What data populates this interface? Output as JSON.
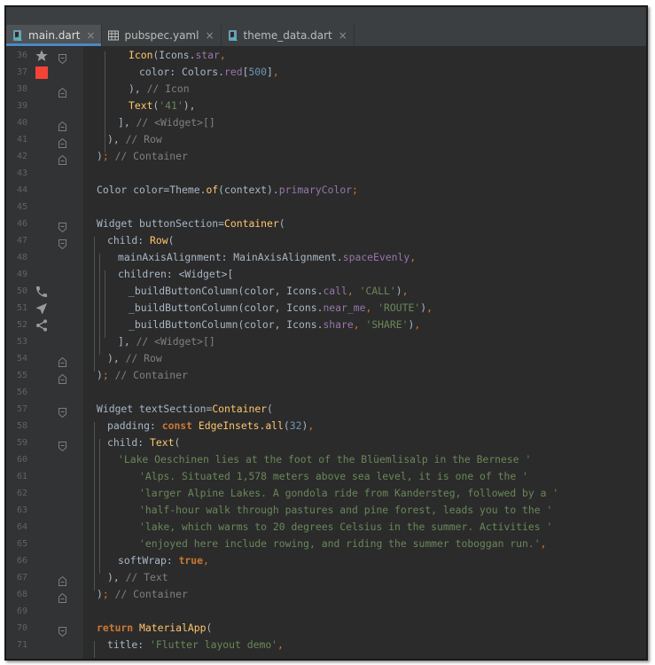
{
  "tabs": [
    {
      "label": "main.dart",
      "icon": "dart-file-icon",
      "active": true
    },
    {
      "label": "pubspec.yaml",
      "icon": "table-file-icon",
      "active": false
    },
    {
      "label": "theme_data.dart",
      "icon": "dart-file-icon",
      "active": false
    }
  ],
  "close_glyph": "×",
  "colors": {
    "background": "#2b2b2b",
    "gutter": "#313335",
    "keyword": "#cc7832",
    "string": "#6a8759",
    "number": "#6897bb",
    "property": "#9876aa",
    "class": "#ffc66d",
    "comment": "#808080",
    "text": "#a9b7c6",
    "active_tab_underline": "#4a88c7"
  },
  "lines": [
    {
      "n": "36",
      "marker": "star-icon",
      "fold": "cap",
      "tokens": [
        [
          "cls",
          "Icon"
        ],
        [
          "plain",
          "(Icons."
        ],
        [
          "prop",
          "star"
        ],
        [
          "pun",
          ","
        ]
      ]
    },
    {
      "n": "37",
      "marker": "red-color-swatch-icon",
      "fold": "",
      "tokens": [
        [
          "plain",
          "color: Colors."
        ],
        [
          "prop",
          "red"
        ],
        [
          "plain",
          "["
        ],
        [
          "num",
          "500"
        ],
        [
          "plain",
          "]"
        ],
        [
          "pun",
          ","
        ]
      ]
    },
    {
      "n": "38",
      "marker": "",
      "fold": "end",
      "tokens": [
        [
          "plain",
          "), "
        ],
        [
          "cmt",
          "// Icon"
        ]
      ]
    },
    {
      "n": "39",
      "marker": "",
      "fold": "",
      "tokens": [
        [
          "cls",
          "Text"
        ],
        [
          "plain",
          "("
        ],
        [
          "str",
          "'41'"
        ],
        [
          "plain",
          "),"
        ]
      ]
    },
    {
      "n": "40",
      "marker": "",
      "fold": "end",
      "tokens": [
        [
          "plain",
          "], "
        ],
        [
          "cmt",
          "// <Widget>[]"
        ]
      ]
    },
    {
      "n": "41",
      "marker": "",
      "fold": "end",
      "tokens": [
        [
          "plain",
          "), "
        ],
        [
          "cmt",
          "// Row"
        ]
      ]
    },
    {
      "n": "42",
      "marker": "",
      "fold": "end",
      "tokens": [
        [
          "plain",
          ")"
        ],
        [
          "pun",
          ";"
        ],
        [
          "plain",
          " "
        ],
        [
          "cmt",
          "// Container"
        ]
      ]
    },
    {
      "n": "43",
      "marker": "",
      "fold": "",
      "tokens": []
    },
    {
      "n": "44",
      "marker": "",
      "fold": "",
      "tokens": [
        [
          "plain",
          "Color color=Theme."
        ],
        [
          "fn",
          "of"
        ],
        [
          "plain",
          "(context)."
        ],
        [
          "prop",
          "primaryColor"
        ],
        [
          "pun",
          ";"
        ]
      ]
    },
    {
      "n": "45",
      "marker": "",
      "fold": "",
      "tokens": []
    },
    {
      "n": "46",
      "marker": "",
      "fold": "cap",
      "tokens": [
        [
          "plain",
          "Widget buttonSection="
        ],
        [
          "cls",
          "Container"
        ],
        [
          "plain",
          "("
        ]
      ]
    },
    {
      "n": "47",
      "marker": "",
      "fold": "cap",
      "tokens": [
        [
          "plain",
          "child: "
        ],
        [
          "cls",
          "Row"
        ],
        [
          "plain",
          "("
        ]
      ]
    },
    {
      "n": "48",
      "marker": "",
      "fold": "",
      "tokens": [
        [
          "plain",
          "mainAxisAlignment: MainAxisAlignment."
        ],
        [
          "prop",
          "spaceEvenly"
        ],
        [
          "pun",
          ","
        ]
      ]
    },
    {
      "n": "49",
      "marker": "",
      "fold": "",
      "tokens": [
        [
          "plain",
          "children: <Widget>["
        ]
      ]
    },
    {
      "n": "50",
      "marker": "phone-icon",
      "fold": "",
      "tokens": [
        [
          "plain",
          "_buildButtonColumn(color, Icons."
        ],
        [
          "prop",
          "call"
        ],
        [
          "pun",
          ", "
        ],
        [
          "str",
          "'CALL'"
        ],
        [
          "plain",
          ")"
        ],
        [
          "pun",
          ","
        ]
      ]
    },
    {
      "n": "51",
      "marker": "navigation-arrow-icon",
      "fold": "",
      "tokens": [
        [
          "plain",
          "_buildButtonColumn(color, Icons."
        ],
        [
          "prop",
          "near_me"
        ],
        [
          "pun",
          ", "
        ],
        [
          "str",
          "'ROUTE'"
        ],
        [
          "plain",
          ")"
        ],
        [
          "pun",
          ","
        ]
      ]
    },
    {
      "n": "52",
      "marker": "share-icon",
      "fold": "",
      "tokens": [
        [
          "plain",
          "_buildButtonColumn(color, Icons."
        ],
        [
          "prop",
          "share"
        ],
        [
          "pun",
          ", "
        ],
        [
          "str",
          "'SHARE'"
        ],
        [
          "plain",
          ")"
        ],
        [
          "pun",
          ","
        ]
      ]
    },
    {
      "n": "53",
      "marker": "",
      "fold": "",
      "tokens": [
        [
          "plain",
          "], "
        ],
        [
          "cmt",
          "// <Widget>[]"
        ]
      ]
    },
    {
      "n": "54",
      "marker": "",
      "fold": "end",
      "tokens": [
        [
          "plain",
          "), "
        ],
        [
          "cmt",
          "// Row"
        ]
      ]
    },
    {
      "n": "55",
      "marker": "",
      "fold": "end",
      "tokens": [
        [
          "plain",
          ")"
        ],
        [
          "pun",
          ";"
        ],
        [
          "plain",
          " "
        ],
        [
          "cmt",
          "// Container"
        ]
      ]
    },
    {
      "n": "56",
      "marker": "",
      "fold": "",
      "tokens": []
    },
    {
      "n": "57",
      "marker": "",
      "fold": "cap",
      "tokens": [
        [
          "plain",
          "Widget textSection="
        ],
        [
          "cls",
          "Container"
        ],
        [
          "plain",
          "("
        ]
      ]
    },
    {
      "n": "58",
      "marker": "",
      "fold": "",
      "tokens": [
        [
          "plain",
          "padding: "
        ],
        [
          "kw",
          "const "
        ],
        [
          "cls",
          "EdgeInsets."
        ],
        [
          "fn",
          "all"
        ],
        [
          "plain",
          "("
        ],
        [
          "num",
          "32"
        ],
        [
          "plain",
          ")"
        ],
        [
          "pun",
          ","
        ]
      ]
    },
    {
      "n": "59",
      "marker": "",
      "fold": "cap",
      "tokens": [
        [
          "plain",
          "child: "
        ],
        [
          "cls",
          "Text"
        ],
        [
          "plain",
          "("
        ]
      ]
    },
    {
      "n": "60",
      "marker": "",
      "fold": "",
      "tokens": [
        [
          "str",
          "'Lake Oeschinen lies at the foot of the Blüemlisalp in the Bernese '"
        ]
      ]
    },
    {
      "n": "61",
      "marker": "",
      "fold": "",
      "tokens": [
        [
          "str",
          "'Alps. Situated 1,578 meters above sea level, it is one of the '"
        ]
      ]
    },
    {
      "n": "62",
      "marker": "",
      "fold": "",
      "tokens": [
        [
          "str",
          "'larger Alpine Lakes. A gondola ride from Kandersteg, followed by a '"
        ]
      ]
    },
    {
      "n": "63",
      "marker": "",
      "fold": "",
      "tokens": [
        [
          "str",
          "'half-hour walk through pastures and pine forest, leads you to the '"
        ]
      ]
    },
    {
      "n": "64",
      "marker": "",
      "fold": "",
      "tokens": [
        [
          "str",
          "'lake, which warms to 20 degrees Celsius in the summer. Activities '"
        ]
      ]
    },
    {
      "n": "65",
      "marker": "",
      "fold": "",
      "tokens": [
        [
          "str",
          "'enjoyed here include rowing, and riding the summer toboggan run.'"
        ],
        [
          "pun",
          ","
        ]
      ]
    },
    {
      "n": "66",
      "marker": "",
      "fold": "",
      "tokens": [
        [
          "plain",
          "softWrap: "
        ],
        [
          "kw",
          "true"
        ],
        [
          "pun",
          ","
        ]
      ]
    },
    {
      "n": "67",
      "marker": "",
      "fold": "end",
      "tokens": [
        [
          "plain",
          "), "
        ],
        [
          "cmt",
          "// Text"
        ]
      ]
    },
    {
      "n": "68",
      "marker": "",
      "fold": "end",
      "tokens": [
        [
          "plain",
          ")"
        ],
        [
          "pun",
          ";"
        ],
        [
          "plain",
          " "
        ],
        [
          "cmt",
          "// Container"
        ]
      ]
    },
    {
      "n": "69",
      "marker": "",
      "fold": "",
      "tokens": []
    },
    {
      "n": "70",
      "marker": "",
      "fold": "cap",
      "tokens": [
        [
          "kw",
          "return "
        ],
        [
          "cls",
          "MaterialApp"
        ],
        [
          "plain",
          "("
        ]
      ]
    },
    {
      "n": "71",
      "marker": "",
      "fold": "",
      "tokens": [
        [
          "plain",
          "title: "
        ],
        [
          "str",
          "'Flutter layout demo'"
        ],
        [
          "pun",
          ","
        ]
      ]
    }
  ]
}
